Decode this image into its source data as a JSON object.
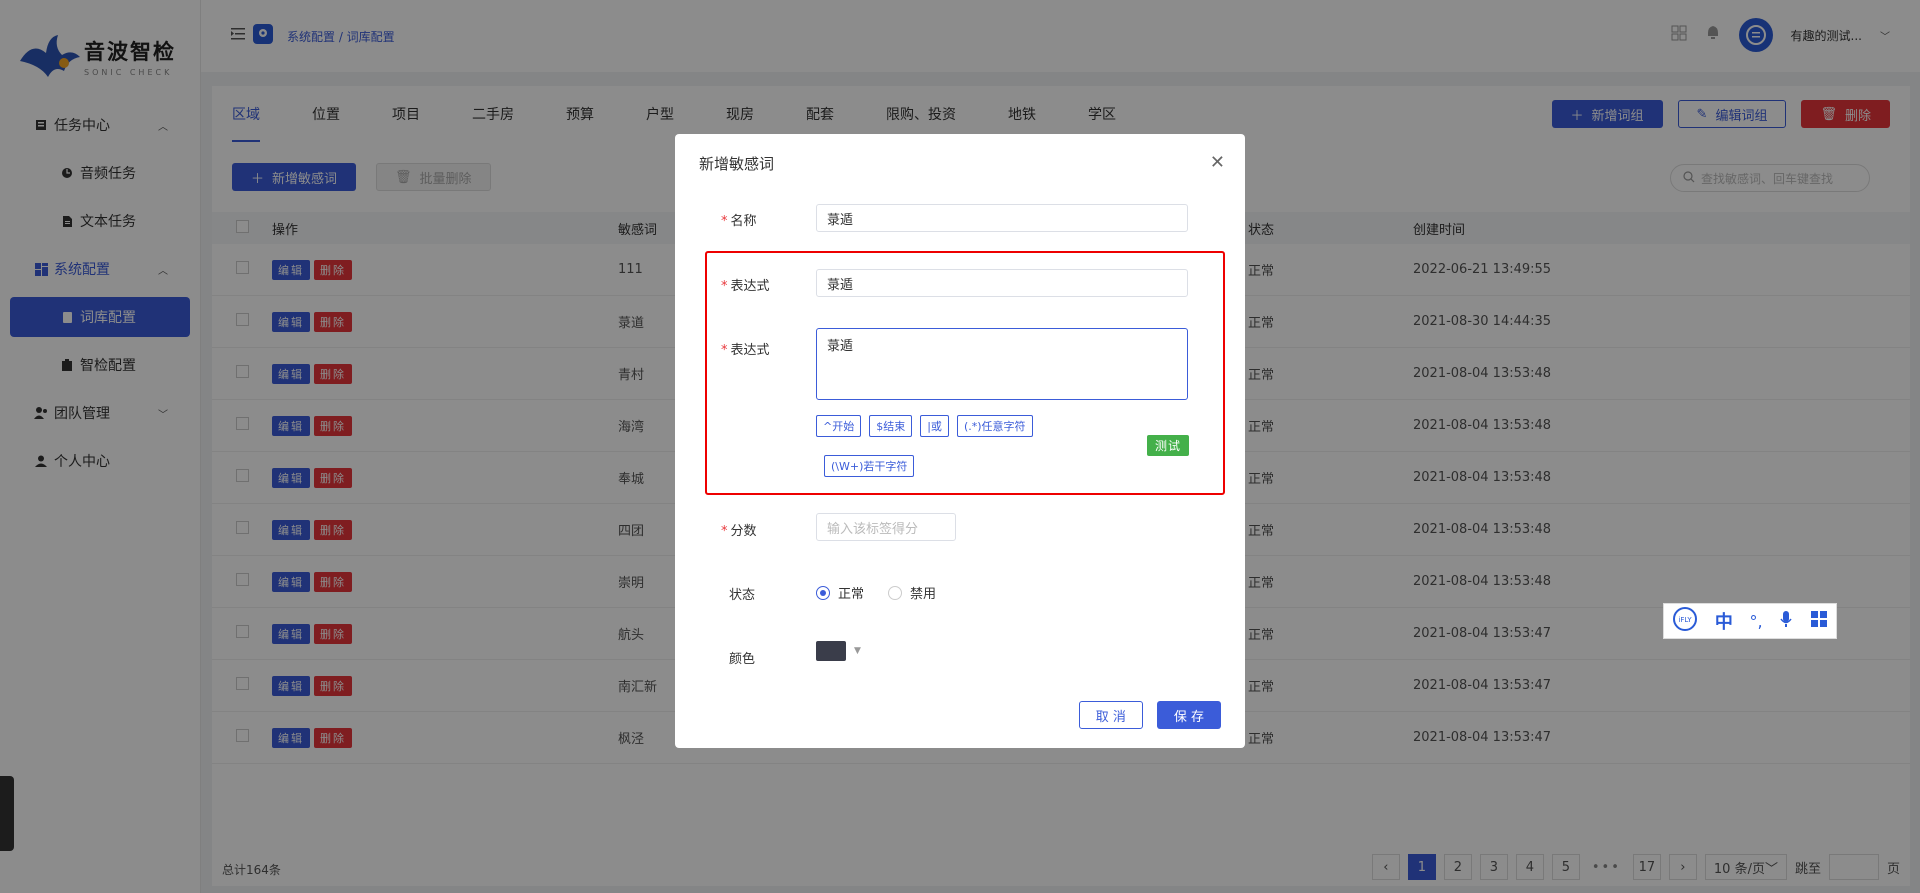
{
  "logo": {
    "title": "音波智检",
    "sub": "SONIC CHECK"
  },
  "menu": [
    {
      "label": "任务中心",
      "type": "parent",
      "icon": "task-icon"
    },
    {
      "label": "音频任务",
      "type": "sub",
      "icon": "audio-icon"
    },
    {
      "label": "文本任务",
      "type": "sub",
      "icon": "doc-icon"
    },
    {
      "label": "系统配置",
      "type": "parent-active",
      "icon": "grid-icon"
    },
    {
      "label": "词库配置",
      "type": "active",
      "icon": "book-icon"
    },
    {
      "label": "智检配置",
      "type": "sub",
      "icon": "clipboard-icon"
    },
    {
      "label": "团队管理",
      "type": "parent-collapsed",
      "icon": "team-icon"
    },
    {
      "label": "个人中心",
      "type": "plain",
      "icon": "user-icon"
    }
  ],
  "header": {
    "breadcrumb": "系统配置 / 词库配置",
    "username": "有趣的测试..."
  },
  "tabs": [
    "区域",
    "位置",
    "项目",
    "二手房",
    "预算",
    "户型",
    "现房",
    "配套",
    "限购、投资",
    "地铁",
    "学区"
  ],
  "top_actions": {
    "add_group": "新增词组",
    "edit_group": "编辑词组",
    "delete": "删除"
  },
  "sub_actions": {
    "add_word": "新增敏感词",
    "batch_delete": "批量删除"
  },
  "search": {
    "placeholder": "查找敏感词、回车键查找"
  },
  "table": {
    "headers": {
      "op": "操作",
      "word": "敏感词",
      "status": "状态",
      "time": "创建时间"
    },
    "edit_label": "编辑",
    "delete_label": "删除",
    "rows": [
      {
        "word": "111",
        "status": "正常",
        "time": "2022-06-21 13:49:55"
      },
      {
        "word": "菉道",
        "status": "正常",
        "time": "2021-08-30 14:44:35"
      },
      {
        "word": "青村",
        "status": "正常",
        "time": "2021-08-04 13:53:48"
      },
      {
        "word": "海湾",
        "status": "正常",
        "time": "2021-08-04 13:53:48"
      },
      {
        "word": "奉城",
        "status": "正常",
        "time": "2021-08-04 13:53:48"
      },
      {
        "word": "四团",
        "status": "正常",
        "time": "2021-08-04 13:53:48"
      },
      {
        "word": "崇明",
        "status": "正常",
        "time": "2021-08-04 13:53:48"
      },
      {
        "word": "航头",
        "status": "正常",
        "time": "2021-08-04 13:53:47"
      },
      {
        "word": "南汇新",
        "status": "正常",
        "time": "2021-08-04 13:53:47"
      },
      {
        "word": "枫泾",
        "status": "正常",
        "time": "2021-08-04 13:53:47"
      }
    ]
  },
  "footer": {
    "total": "总计164条",
    "pages": [
      "1",
      "2",
      "3",
      "4",
      "5",
      "•••",
      "17"
    ],
    "page_size": "10 条/页",
    "jump": "跳至",
    "page_unit": "页"
  },
  "dialog": {
    "title": "新增敏感词",
    "name_label": "名称",
    "name_value": "菉遁",
    "expr_label": "表达式",
    "expr_value": "菉遁",
    "expr_label2": "表达式",
    "expr_textarea": "菉遁",
    "chips": [
      "^开始",
      "$结束",
      "|或",
      "(.*)任意字符",
      "(\\W+)若干字符"
    ],
    "test_label": "测试",
    "score_label": "分数",
    "score_placeholder": "输入该标签得分",
    "status_label": "状态",
    "status_normal": "正常",
    "status_disabled": "禁用",
    "color_label": "颜色",
    "cancel_label": "取 消",
    "save_label": "保 存"
  },
  "ifly": {
    "brand": "iFLY",
    "lang": "中"
  },
  "colors": {
    "primary": "#3b5cd9",
    "danger": "#e8363b",
    "success": "#44b04a",
    "highlight": "#e00000",
    "swatch": "#3a3d4a"
  }
}
